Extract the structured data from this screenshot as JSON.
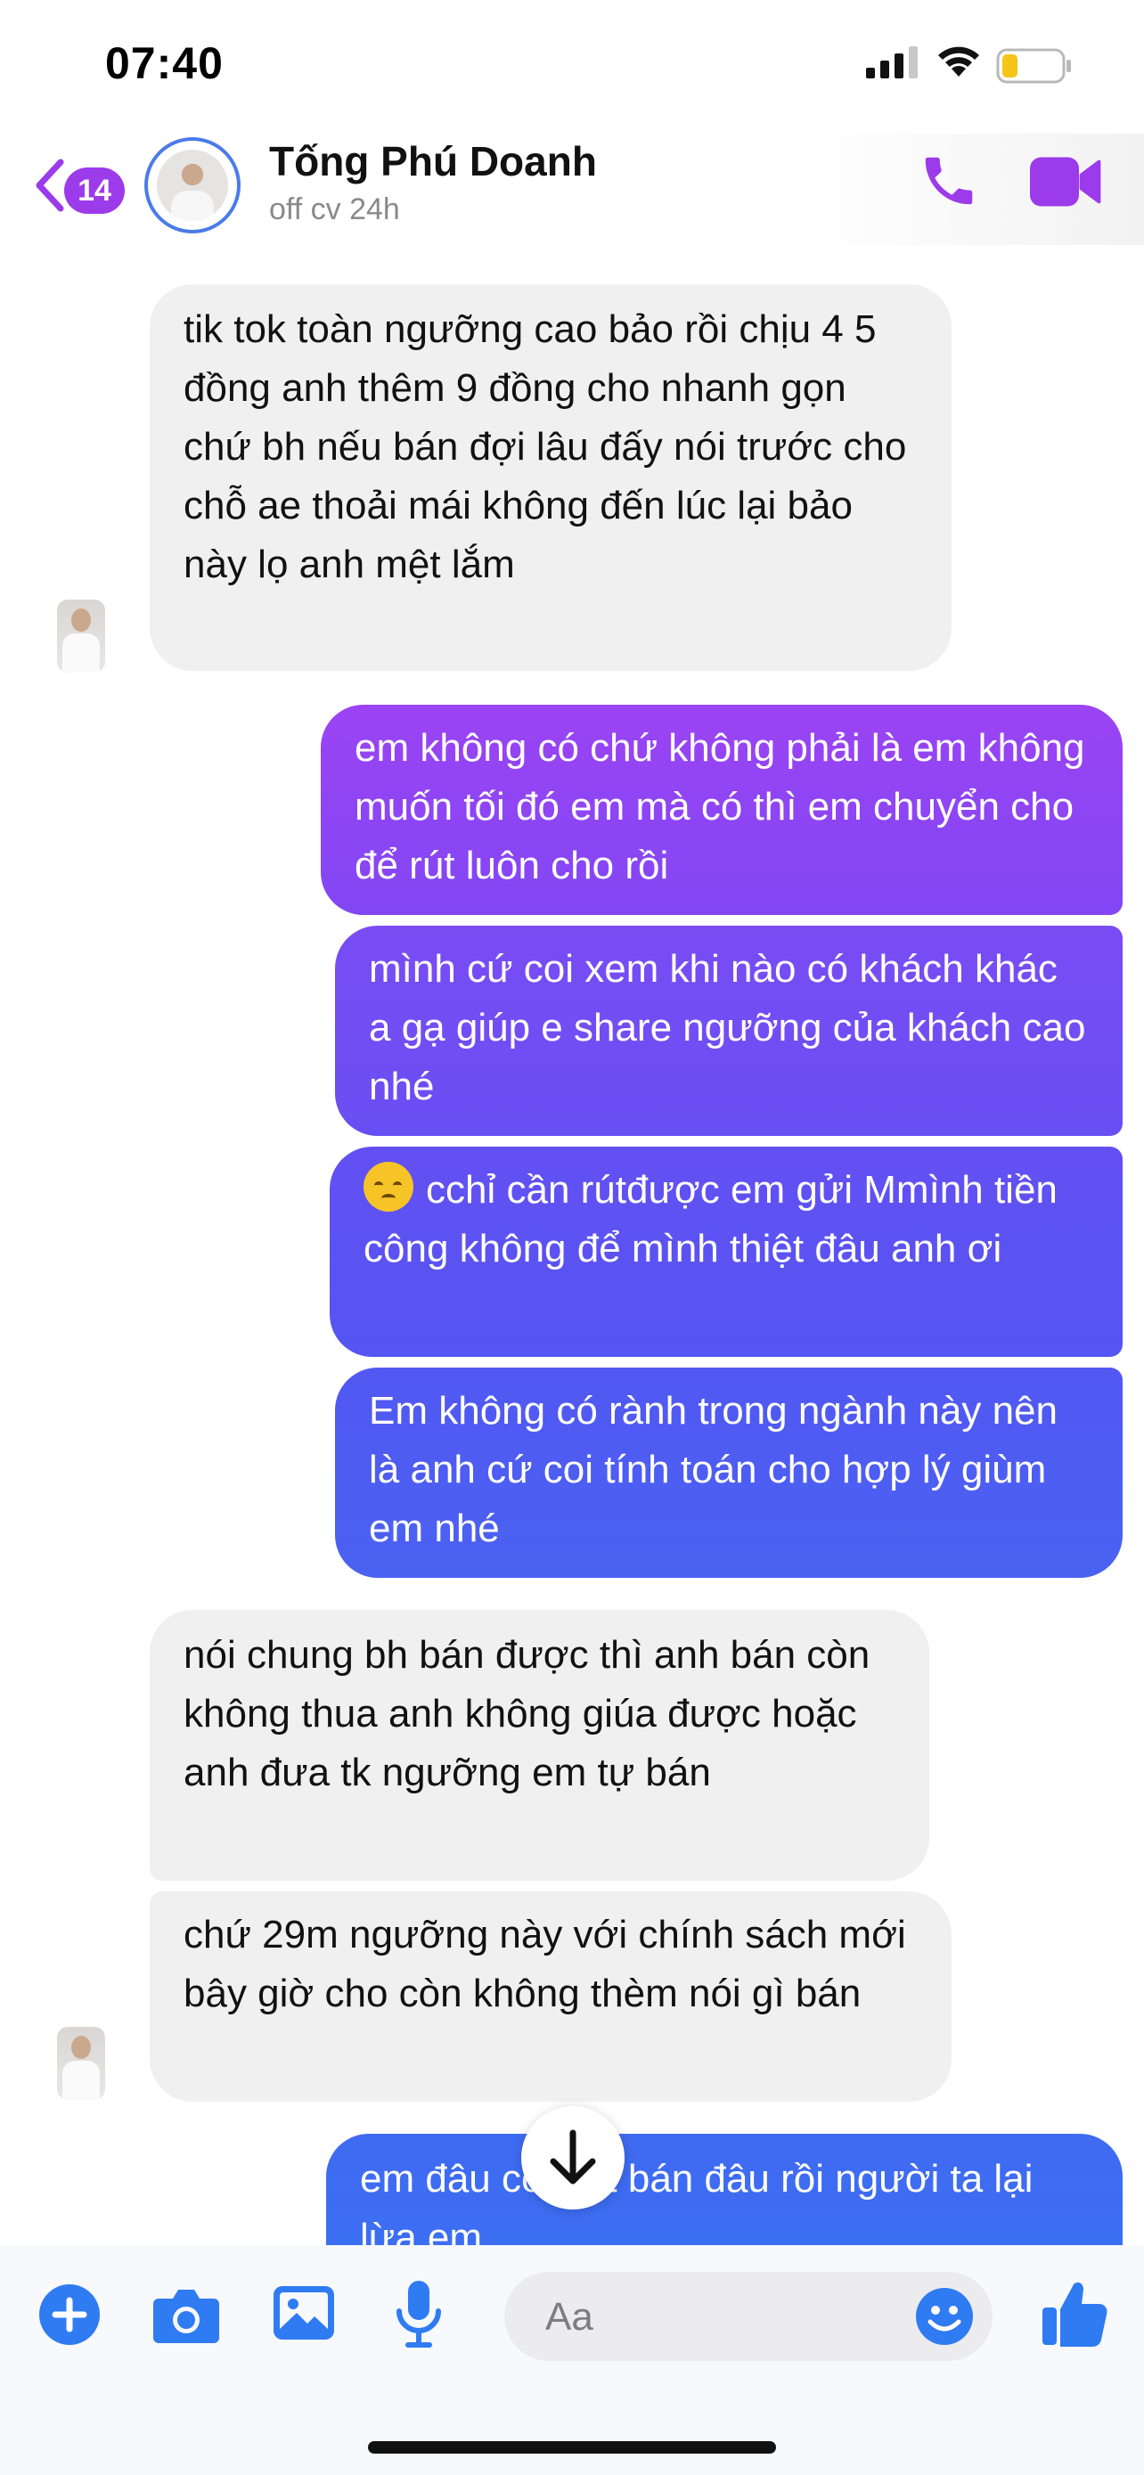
{
  "status_bar": {
    "time": "07:40"
  },
  "header": {
    "back_count": "14",
    "contact_name": "Tống Phú Doanh",
    "contact_status": "off cv 24h"
  },
  "messages": [
    {
      "side": "in",
      "text": "tik tok toàn ngưỡng cao bảo rồi chịu 4 5 đồng anh thêm 9 đồng cho nhanh gọn chứ bh nếu bán đợi lâu đấy nói trước cho chỗ ae thoải mái không đến lúc lại bảo này lọ anh mệt lắm"
    },
    {
      "side": "out",
      "text": "em không có chứ không phải là em không muốn tối đó em mà có thì em chuyển cho để rút luôn cho rồi"
    },
    {
      "side": "out",
      "text": "mình cứ coi xem khi nào có khách khác a gạ giúp e share ngưỡng của khách cao nhé"
    },
    {
      "side": "out",
      "emoji": "disappointed-face",
      "text": "cchỉ cần rútđược em gửi Mmình tiền công không để mình thiệt đâu anh ơi"
    },
    {
      "side": "out",
      "text": "Em không có rành trong ngành này nên là anh cứ coi tính toán cho hợp lý giùm em nhé"
    },
    {
      "side": "in",
      "text": "nói chung bh bán được thì anh bán còn không thua anh không giúa được hoặc anh đưa tk ngưỡng em tự bán"
    },
    {
      "side": "in",
      "text": "chứ 29m ngưỡng này với chính sách mới bây giờ cho còn không thèm nói gì bán"
    },
    {
      "side": "out",
      "text": "em đâu có biết bán đâu rồi người ta lại lừa em"
    }
  ],
  "composer": {
    "placeholder": "Aa"
  },
  "colors": {
    "accent": "#9b3bea",
    "incoming_bubble": "#f0f0f0",
    "outgoing_top": "#9b44f3",
    "outgoing_bottom": "#3a70f2",
    "composer_icons": "#2f7bf2"
  }
}
